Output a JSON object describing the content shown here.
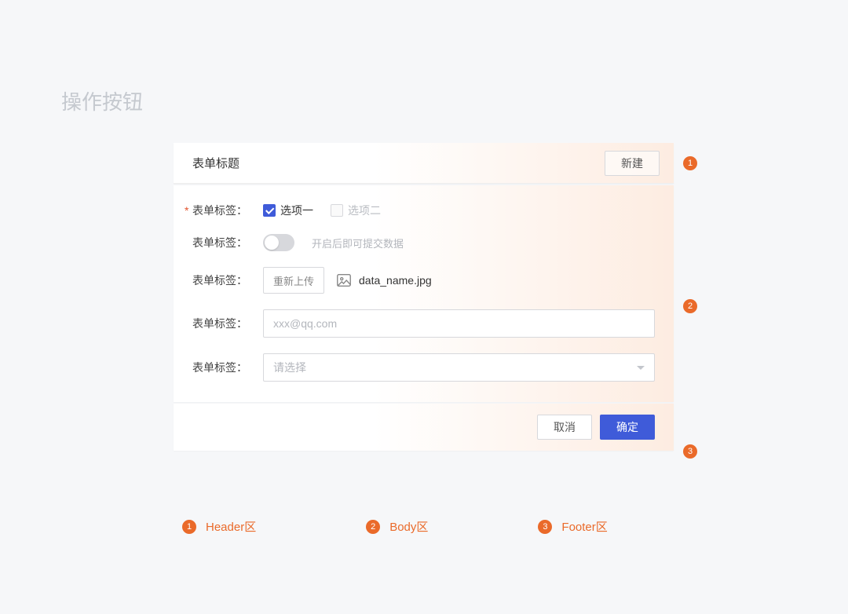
{
  "page": {
    "title": "操作按钮"
  },
  "panel": {
    "header": {
      "title": "表单标题",
      "action_label": "新建"
    },
    "body": {
      "rows": {
        "checkbox": {
          "label": "表单标签：",
          "option1": "选项一",
          "option2": "选项二"
        },
        "switch": {
          "label": "表单标签：",
          "hint": "开启后即可提交数据"
        },
        "upload": {
          "label": "表单标签：",
          "button": "重新上传",
          "filename": "data_name.jpg"
        },
        "email": {
          "label": "表单标签：",
          "placeholder": "xxx@qq.com",
          "value": ""
        },
        "select": {
          "label": "表单标签：",
          "placeholder": "请选择"
        }
      }
    },
    "footer": {
      "cancel": "取消",
      "confirm": "确定"
    }
  },
  "annotations": {
    "b1": "1",
    "b2": "2",
    "b3": "3"
  },
  "legend": {
    "item1": "Header区",
    "item2": "Body区",
    "item3": "Footer区"
  }
}
